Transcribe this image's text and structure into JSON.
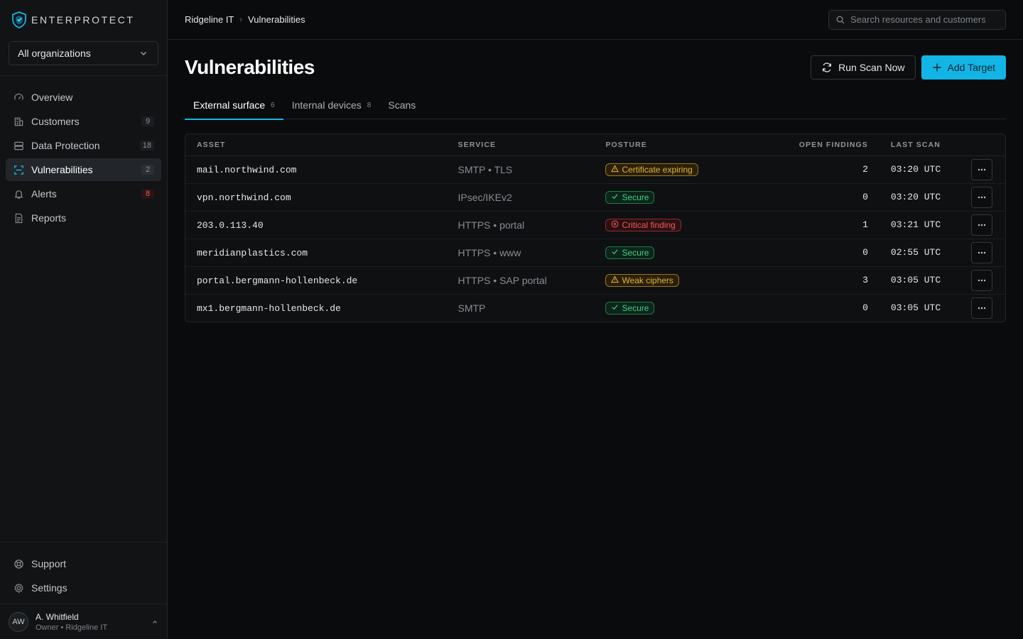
{
  "brand": {
    "name": "ENTERPROTECT",
    "accent": "#12b5e6"
  },
  "org_select": {
    "value": "All organizations"
  },
  "nav": [
    {
      "label": "Overview",
      "icon": "gauge-icon",
      "count": null,
      "active": false
    },
    {
      "label": "Customers",
      "icon": "building-icon",
      "count": "9",
      "active": false
    },
    {
      "label": "Data Protection",
      "icon": "server-icon",
      "count": "18",
      "active": false
    },
    {
      "label": "Vulnerabilities",
      "icon": "scan-icon",
      "count": "2",
      "active": true
    },
    {
      "label": "Alerts",
      "icon": "bell-icon",
      "count": "8",
      "active": false,
      "alert": true
    },
    {
      "label": "Reports",
      "icon": "document-icon",
      "count": null,
      "active": false
    }
  ],
  "bottom_nav": [
    {
      "label": "Support",
      "icon": "lifebuoy-icon"
    },
    {
      "label": "Settings",
      "icon": "gear-icon"
    }
  ],
  "user": {
    "initials": "AW",
    "name": "A. Whitfield",
    "role": "Owner • Ridgeline IT"
  },
  "breadcrumb": {
    "parent": "Ridgeline IT",
    "current": "Vulnerabilities"
  },
  "search": {
    "placeholder": "Search resources and customers"
  },
  "page": {
    "title": "Vulnerabilities",
    "run_scan_label": "Run Scan Now",
    "add_target_label": "Add Target"
  },
  "tabs": [
    {
      "label": "External surface",
      "count": "6",
      "active": true
    },
    {
      "label": "Internal devices",
      "count": "8",
      "active": false
    },
    {
      "label": "Scans",
      "count": "",
      "active": false
    }
  ],
  "table": {
    "headers": {
      "asset": "ASSET",
      "service": "SERVICE",
      "posture": "POSTURE",
      "findings": "OPEN FINDINGS",
      "last_scan": "LAST SCAN"
    },
    "rows": [
      {
        "asset": "mail.northwind.com",
        "service": "SMTP • TLS",
        "posture": "Certificate expiring",
        "level": "warn",
        "findings": "2",
        "last_scan": "03:20 UTC"
      },
      {
        "asset": "vpn.northwind.com",
        "service": "IPsec/IKEv2",
        "posture": "Secure",
        "level": "ok",
        "findings": "0",
        "last_scan": "03:20 UTC"
      },
      {
        "asset": "203.0.113.40",
        "service": "HTTPS • portal",
        "posture": "Critical finding",
        "level": "crit",
        "findings": "1",
        "last_scan": "03:21 UTC"
      },
      {
        "asset": "meridianplastics.com",
        "service": "HTTPS • www",
        "posture": "Secure",
        "level": "ok",
        "findings": "0",
        "last_scan": "02:55 UTC"
      },
      {
        "asset": "portal.bergmann-hollenbeck.de",
        "service": "HTTPS • SAP portal",
        "posture": "Weak ciphers",
        "level": "warn",
        "findings": "3",
        "last_scan": "03:05 UTC"
      },
      {
        "asset": "mx1.bergmann-hollenbeck.de",
        "service": "SMTP",
        "posture": "Secure",
        "level": "ok",
        "findings": "0",
        "last_scan": "03:05 UTC"
      }
    ]
  }
}
